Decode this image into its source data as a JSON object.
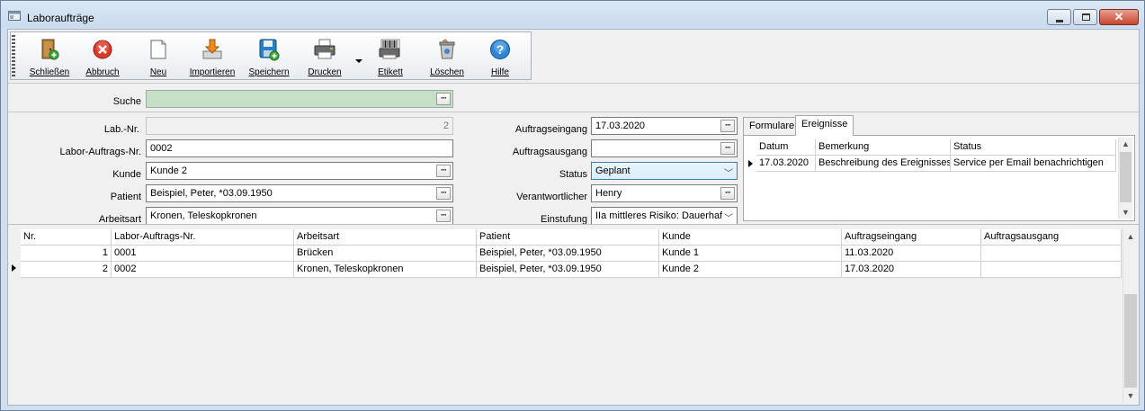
{
  "window": {
    "title": "Laboraufträge",
    "min_glyph": "",
    "close_glyph": "✕"
  },
  "toolbar": {
    "items": [
      {
        "label": "Schließen",
        "icon": "door-exit-icon"
      },
      {
        "label": "Abbruch",
        "icon": "cancel-icon"
      },
      {
        "label": "Neu",
        "icon": "new-document-icon"
      },
      {
        "label": "Importieren",
        "icon": "import-icon"
      },
      {
        "label": "Speichern",
        "icon": "save-disk-icon"
      },
      {
        "label": "Drucken",
        "icon": "printer-icon"
      },
      {
        "label": "Etikett",
        "icon": "barcode-label-icon"
      },
      {
        "label": "Löschen",
        "icon": "trash-icon"
      },
      {
        "label": "Hilfe",
        "icon": "help-icon"
      }
    ]
  },
  "search": {
    "label": "Suche",
    "value": "",
    "button": "···"
  },
  "form": {
    "lab_nr": {
      "label": "Lab.-Nr.",
      "value": "2"
    },
    "auftrags_nr": {
      "label": "Labor-Auftrags-Nr.",
      "value": "0002"
    },
    "kunde": {
      "label": "Kunde",
      "value": "Kunde 2"
    },
    "patient": {
      "label": "Patient",
      "value": "Beispiel, Peter, *03.09.1950"
    },
    "arbeitsart": {
      "label": "Arbeitsart",
      "value": "Kronen, Teleskopkronen"
    },
    "auftragseingang": {
      "label": "Auftragseingang",
      "value": "17.03.2020"
    },
    "auftragsausgang": {
      "label": "Auftragsausgang",
      "value": ""
    },
    "status": {
      "label": "Status",
      "value": "Geplant"
    },
    "verantwortlicher": {
      "label": "Verantwortlicher",
      "value": "Henry"
    },
    "einstufung": {
      "label": "Einstufung",
      "value": "IIa mittleres Risiko: Dauerhafte"
    },
    "ellipsis": "···",
    "chevron": "﹀"
  },
  "tabs": {
    "items": [
      "Formulare",
      "Ereignisse"
    ],
    "active": "Ereignisse"
  },
  "events": {
    "columns": [
      "Datum",
      "Bemerkung",
      "Status"
    ],
    "rows": [
      [
        "17.03.2020",
        "Beschreibung des Ereignisses",
        "Service per Email benachrichtigen"
      ]
    ]
  },
  "orders": {
    "columns": [
      "Nr.",
      "Labor-Auftrags-Nr.",
      "Arbeitsart",
      "Patient",
      "Kunde",
      "Auftragseingang",
      "Auftragsausgang"
    ],
    "rows": [
      [
        "1",
        "0001",
        "Brücken",
        "Beispiel, Peter, *03.09.1950",
        "Kunde 1",
        "11.03.2020",
        ""
      ],
      [
        "2",
        "0002",
        "Kronen, Teleskopkronen",
        "Beispiel, Peter, *03.09.1950",
        "Kunde 2",
        "17.03.2020",
        ""
      ]
    ]
  },
  "scroll": {
    "up": "▲",
    "down": "▼"
  },
  "colors": {
    "search_bg": "#c6e0c6",
    "status_focus": "#3c7fb1",
    "close_button": "#c7452e"
  }
}
